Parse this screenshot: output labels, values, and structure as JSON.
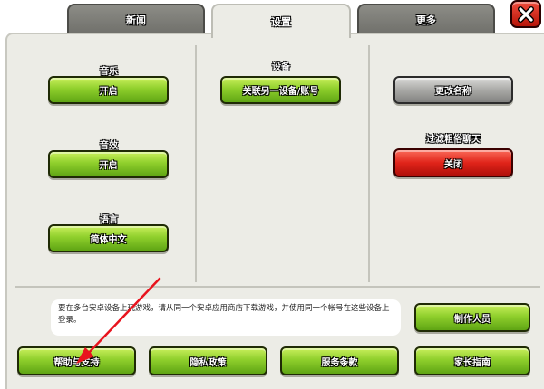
{
  "tabs": [
    {
      "label": "新闻"
    },
    {
      "label": "设置"
    },
    {
      "label": "更多"
    }
  ],
  "close_glyph": "X",
  "settings": {
    "music": {
      "label": "音乐",
      "button": "开启"
    },
    "sound": {
      "label": "音效",
      "button": "开启"
    },
    "language": {
      "label": "语言",
      "button": "简体中文"
    },
    "device": {
      "label": "设备",
      "button": "关联另一设备/账号"
    },
    "rename": {
      "button": "更改名称"
    },
    "chat_filter": {
      "label": "过滤粗俗聊天",
      "button": "关闭"
    }
  },
  "info_text": "要在多台安卓设备上玩游戏，请从同一个安卓应用商店下载游戏，并使用同一个帐号在这些设备上登录。",
  "bottom_buttons": {
    "credits": "制作人员",
    "help": "帮助与支持",
    "privacy": "隐私政策",
    "terms": "服务条款",
    "parents": "家长指南"
  },
  "colors": {
    "green_button": "#8fcf2c",
    "gray_button": "#a9a9a6",
    "red_button": "#e0241a",
    "panel_bg": "#ecece6",
    "annotation_arrow": "#e8141e"
  }
}
